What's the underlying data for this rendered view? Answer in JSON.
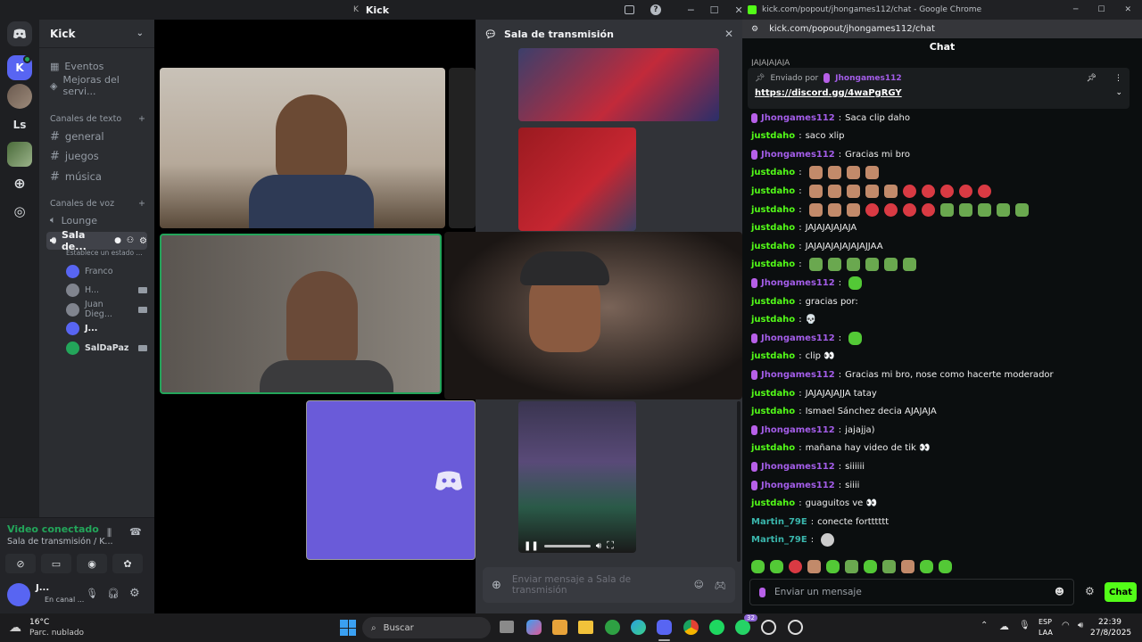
{
  "discord": {
    "title": "Kick",
    "title_prefix": "K",
    "server_initials": [
      "K",
      "Ls"
    ],
    "server_name": "Kick",
    "items": [
      "Eventos",
      "Mejoras del servi..."
    ],
    "text_category": "Canales de texto",
    "text_channels": [
      "general",
      "juegos",
      "música"
    ],
    "voice_category": "Canales de voz",
    "voice_channels": [
      "Lounge",
      "Sala de..."
    ],
    "voice_status": "Establece un estado ...",
    "voice_users": [
      "Franco",
      "H...",
      "Juan Dieg...",
      "J...",
      "SalDaPaz"
    ],
    "connection": {
      "status": "Video conectado",
      "location": "Sala de transmisión / K..."
    },
    "user": {
      "name": "J...",
      "status": "En canal ..."
    },
    "stream": {
      "title": "Sala de transmisión",
      "input_placeholder": "Enviar mensaje a Sala de transmisión"
    }
  },
  "chrome": {
    "tab_title": "kick.com/popout/jhongames112/chat - Google Chrome",
    "url": "kick.com/popout/jhongames112/chat",
    "chat_title": "Chat",
    "scrolled_msg": "JAJAJAJAJA",
    "pinned": {
      "label": "Enviado por",
      "user": "Jhongames112",
      "link": "https://discord.gg/4waPgRGY"
    },
    "messages": [
      {
        "user": "Jhongames112",
        "type": "j",
        "text": "Saca clip daho"
      },
      {
        "user": "justdaho",
        "type": "jd",
        "text": "saco xlip"
      },
      {
        "user": "Jhongames112",
        "type": "j",
        "text": "Gracias mi bro"
      },
      {
        "user": "justdaho",
        "type": "jd",
        "text": ""
      },
      {
        "user": "justdaho",
        "type": "jd",
        "text": ""
      },
      {
        "user": "justdaho",
        "type": "jd",
        "text": ""
      },
      {
        "user": "justdaho",
        "type": "jd",
        "text": "JAJAJAJAJAJA"
      },
      {
        "user": "justdaho",
        "type": "jd",
        "text": "JAJAJAJAJAJAJAJJAA"
      },
      {
        "user": "justdaho",
        "type": "jd",
        "text": ""
      },
      {
        "user": "Jhongames112",
        "type": "j",
        "text": ""
      },
      {
        "user": "justdaho",
        "type": "jd",
        "text": "gracias por:"
      },
      {
        "user": "justdaho",
        "type": "jd",
        "text": "💀"
      },
      {
        "user": "Jhongames112",
        "type": "j",
        "text": ""
      },
      {
        "user": "justdaho",
        "type": "jd",
        "text": "clip 👀"
      },
      {
        "user": "Jhongames112",
        "type": "j",
        "text": "Gracias mi bro, nose como hacerte moderador"
      },
      {
        "user": "justdaho",
        "type": "jd",
        "text": "JAJAJAJAJJA tatay"
      },
      {
        "user": "justdaho",
        "type": "jd",
        "text": "Ismael Sánchez decia AJAJAJA"
      },
      {
        "user": "Jhongames112",
        "type": "j",
        "text": "jajajja)"
      },
      {
        "user": "justdaho",
        "type": "jd",
        "text": "mañana hay video de tik 👀"
      },
      {
        "user": "Jhongames112",
        "type": "j",
        "text": "siiiiii"
      },
      {
        "user": "Jhongames112",
        "type": "j",
        "text": "siiii"
      },
      {
        "user": "justdaho",
        "type": "jd",
        "text": "guaguitos ve 👀"
      },
      {
        "user": "Martin_79E",
        "type": "m",
        "text": "conecte fortttttt"
      },
      {
        "user": "Martin_79E",
        "type": "m",
        "text": ""
      }
    ],
    "input_placeholder": "Enviar un mensaje",
    "chat_button": "Chat"
  },
  "taskbar": {
    "temp": "16°C",
    "weather": "Parc. nublado",
    "search": "Buscar",
    "lang": "ESP",
    "lang2": "LAA",
    "time": "22:39",
    "date": "27/8/2025",
    "notif_count": "32"
  },
  "colors": {
    "kick_green": "#53fc18",
    "discord_blurple": "#5865f2",
    "jhon": "#a35de8",
    "martin": "#3ab6ac"
  }
}
